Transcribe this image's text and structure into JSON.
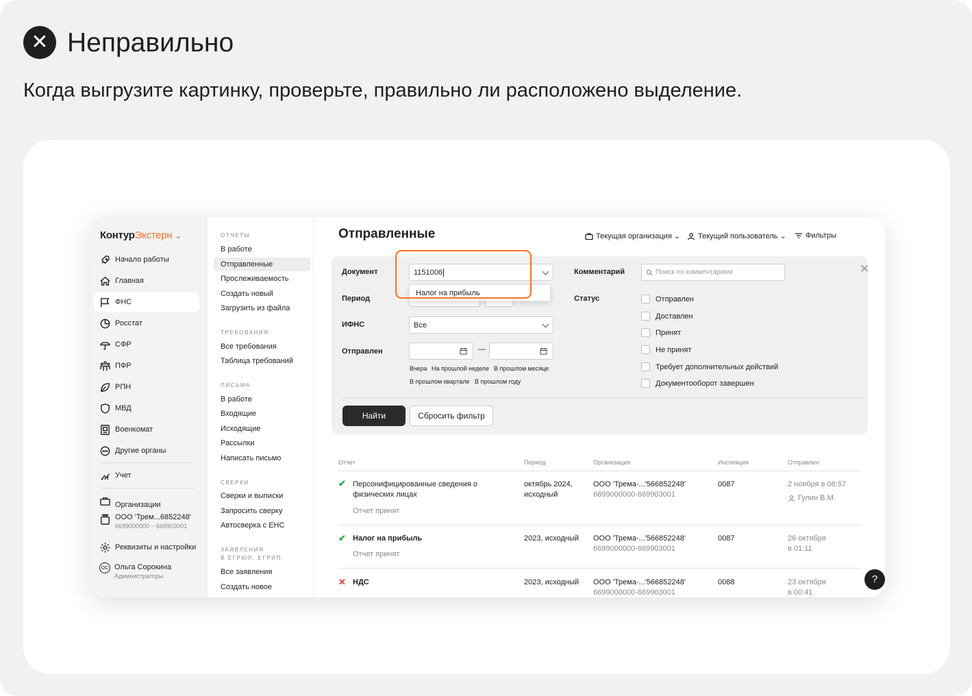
{
  "header": {
    "title": "Неправильно",
    "description": "Когда выгрузите картинку, проверьте, правильно ли расположено выделение."
  },
  "app": {
    "logo": {
      "part1": "Контур",
      "part2": "Экстерн"
    },
    "sidebar": {
      "items": [
        {
          "label": "Начало работы",
          "icon": "rocket-icon"
        },
        {
          "label": "Главная",
          "icon": "home-icon"
        },
        {
          "label": "ФНС",
          "icon": "flag-icon"
        },
        {
          "label": "Росстат",
          "icon": "pie-chart-icon"
        },
        {
          "label": "СФР",
          "icon": "umbrella-icon"
        },
        {
          "label": "ПФР",
          "icon": "people-icon"
        },
        {
          "label": "РПН",
          "icon": "leaf-icon"
        },
        {
          "label": "МВД",
          "icon": "shield-icon"
        },
        {
          "label": "Военкомат",
          "icon": "badge-icon"
        },
        {
          "label": "Другие органы",
          "icon": "more-icon"
        }
      ],
      "accounting": "Учет",
      "organizations": "Организации",
      "org_name": "ООО 'Трем...6852248'",
      "org_ids": "6699000000 – 669903001",
      "settings": "Реквизиты и настройки",
      "user_initials": "ОС",
      "user_name": "Ольга Сорокина",
      "user_role": "Администраторы"
    },
    "subnav": {
      "reports_h": "ОТЧЕТЫ",
      "reports": [
        "В работе",
        "Отправленные",
        "Прослеживаемость",
        "Создать новый",
        "Загрузить из файла"
      ],
      "requirements_h": "ТРЕБОВАНИЯ",
      "requirements": [
        "Все требования",
        "Таблица требований"
      ],
      "letters_h": "ПИСЬМА",
      "letters": [
        "В работе",
        "Входящие",
        "Исходящие",
        "Рассылки",
        "Написать письмо"
      ],
      "checks_h": "СВЕРКИ",
      "checks": [
        "Сверки и выписки",
        "Запросить сверку",
        "Автосверка с ЕНС"
      ],
      "statements_h1": "ЗАЯВЛЕНИЯ",
      "statements_h2": "В ЕГРЮЛ, ЕГРИП",
      "statements": [
        "Все заявления",
        "Создать новое"
      ]
    },
    "main": {
      "title": "Отправленные",
      "current_org": "Текущая организация",
      "current_user": "Текущий пользователь",
      "filters": "Фильтры",
      "filter": {
        "document_label": "Документ",
        "document_value": "1151006",
        "suggestion": "Налог на прибыль",
        "period_label": "Период",
        "ifns_label": "ИФНС",
        "ifns_value": "Все",
        "sent_label": "Отправлен",
        "dash": "—",
        "quick1": [
          "Вчера",
          "На прошлой неделе",
          "В прошлом месяце"
        ],
        "quick2": [
          "В прошлом квартале",
          "В прошлом году"
        ],
        "comment_label": "Комментарий",
        "comment_placeholder": "Поиск по комментариям",
        "status_label": "Статус",
        "statuses": [
          "Отправлен",
          "Доставлен",
          "Принят",
          "Не принят",
          "Требует дополнительных действий",
          "Документооборот завершен"
        ],
        "find": "Найти",
        "reset": "Сбросить фильтр"
      },
      "table": {
        "headers": [
          "Отчет",
          "Период",
          "Организация",
          "Инспекция",
          "Отправлен"
        ],
        "rows": [
          {
            "status": "ok",
            "name1": "Персонифицированные сведения о",
            "name2": "физических лицах",
            "substatus": "Отчет принят",
            "period1": "октябрь 2024,",
            "period2": "исходный",
            "org": "ООО 'Трема-...'566852248'",
            "org_ids": "6699000000-669903001",
            "insp": "0087",
            "sent1": "2 ноября в 08:57",
            "sent2": "Гулин В.М."
          },
          {
            "status": "ok",
            "name1": "Налог на прибыль",
            "substatus": "Отчет принят",
            "period1": "2023, исходный",
            "org": "ООО 'Трема-...'566852248'",
            "org_ids": "6699000000-669903001",
            "insp": "0087",
            "sent1": "26 октября",
            "sent2": "в 01:11"
          },
          {
            "status": "error",
            "name1": "НДС",
            "period1": "2023, исходный",
            "org": "ООО 'Трема-...'566852248'",
            "org_ids": "6699000000-669903001",
            "insp": "0088",
            "sent1": "23 октября",
            "sent2": "в 00:41"
          }
        ]
      },
      "help": "?"
    }
  },
  "colors": {
    "accent": "#f57329",
    "ok": "#2ca94b",
    "error": "#e2363a",
    "dark": "#1f1f1f"
  }
}
